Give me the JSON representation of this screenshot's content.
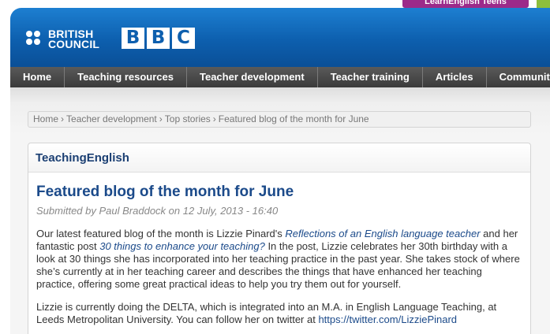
{
  "top_tab": {
    "label": "LearnEnglish Teens"
  },
  "header": {
    "british_council_line1": "BRITISH",
    "british_council_line2": "COUNCIL",
    "bbc_letters": [
      "B",
      "B",
      "C"
    ]
  },
  "nav": {
    "items": [
      "Home",
      "Teaching resources",
      "Teacher development",
      "Teacher training",
      "Articles",
      "Community"
    ]
  },
  "breadcrumb": {
    "items": [
      "Home",
      "Teacher development",
      "Top stories",
      "Featured blog of the month for June"
    ],
    "separator": "›"
  },
  "panel": {
    "title": "TeachingEnglish"
  },
  "article": {
    "title": "Featured blog of the month for June",
    "submitted_prefix": "Submitted by ",
    "author": "Paul Braddock",
    "submitted_on": " on ",
    "date": "12 July, 2013 - 16:40",
    "p1_a": "Our latest featured blog of the month is Lizzie Pinard's ",
    "p1_link1": "Reflections of an English language teacher",
    "p1_b": " and her fantastic post ",
    "p1_link2": "30 things to enhance your teaching?",
    "p1_c": " In the post, Lizzie celebrates her 30th birthday with a look at 30 things she has incorporated into her teaching practice in the past year. She takes stock of where she’s currently at in her teaching career and describes the things that have enhanced her teaching practice, offering some great practical ideas to help you try them out for yourself.",
    "p2_a": "Lizzie is currently doing the DELTA, which is integrated into an M.A. in English Language Teaching, at Leeds Metropolitan University. You can follow her on twitter at ",
    "p2_link": "https://twitter.com/LizziePinard"
  },
  "colors": {
    "header_blue": "#0d5fae",
    "nav_dark": "#3a3a3a",
    "title_blue": "#1b4a8a",
    "tab_purple": "#9c2a8a"
  }
}
